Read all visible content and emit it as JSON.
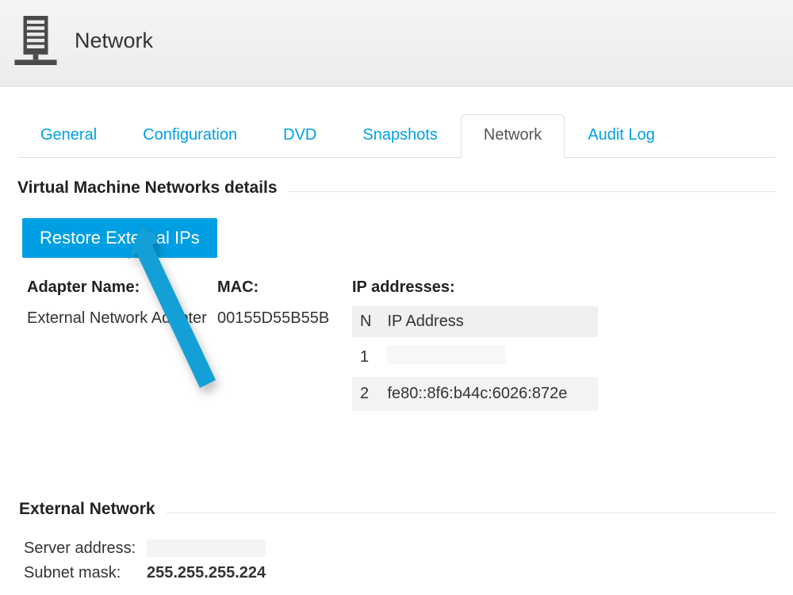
{
  "header": {
    "title": "Network"
  },
  "tabs": [
    {
      "label": "General",
      "active": false
    },
    {
      "label": "Configuration",
      "active": false
    },
    {
      "label": "DVD",
      "active": false
    },
    {
      "label": "Snapshots",
      "active": false
    },
    {
      "label": "Network",
      "active": true
    },
    {
      "label": "Audit Log",
      "active": false
    }
  ],
  "sections": {
    "details": {
      "title": "Virtual Machine Networks details",
      "restore_button": "Restore External IPs",
      "columns": {
        "adapter_name_header": "Adapter Name:",
        "mac_header": "MAC:",
        "ip_header": "IP addresses:"
      },
      "adapter_name_value": "External Network Adapter",
      "mac_value": "00155D55B55B",
      "ip_table": {
        "header_index": "N",
        "header_ip": "IP Address",
        "rows": [
          {
            "n": "1",
            "ip": ""
          },
          {
            "n": "2",
            "ip": "fe80::8f6:b44c:6026:872e"
          }
        ]
      }
    },
    "external_network": {
      "title": "External Network",
      "server_address_label": "Server address:",
      "server_address_value": "",
      "subnet_mask_label": "Subnet mask:",
      "subnet_mask_value": "255.255.255.224"
    }
  }
}
